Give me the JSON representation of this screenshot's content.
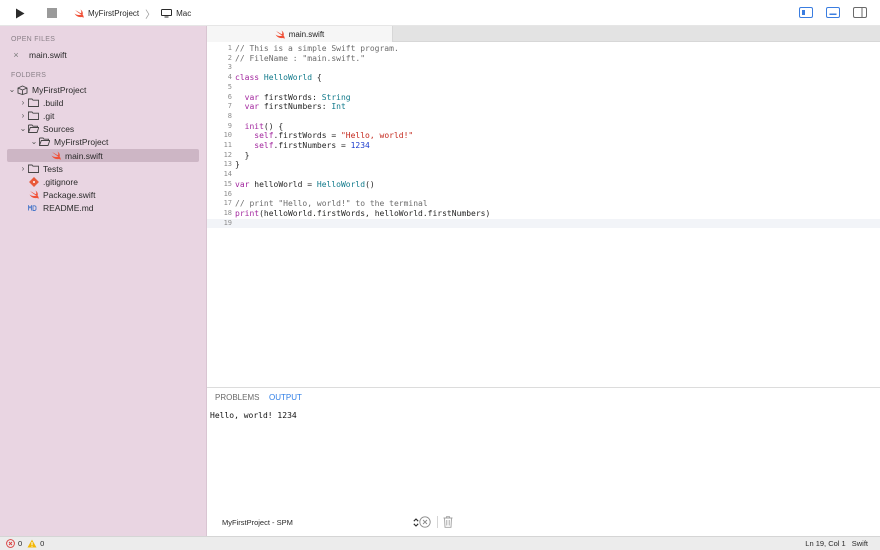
{
  "toolbar": {
    "scheme_project": "MyFirstProject",
    "scheme_destination": "Mac",
    "separator": "〉"
  },
  "sidebar": {
    "open_files_title": "OPEN FILES",
    "open_files": [
      {
        "label": "main.swift"
      }
    ],
    "folders_title": "FOLDERS",
    "tree": [
      {
        "label": "MyFirstProject",
        "chevron": "⌄",
        "icon": "package-icon"
      },
      {
        "label": ".build",
        "chevron": "›",
        "icon": "folder-icon"
      },
      {
        "label": ".git",
        "chevron": "›",
        "icon": "folder-icon"
      },
      {
        "label": "Sources",
        "chevron": "⌄",
        "icon": "folder-open-icon"
      },
      {
        "label": "MyFirstProject",
        "chevron": "⌄",
        "icon": "folder-open-icon"
      },
      {
        "label": "main.swift",
        "chevron": "",
        "icon": "swift-icon",
        "selected": true
      },
      {
        "label": "Tests",
        "chevron": "›",
        "icon": "folder-icon"
      },
      {
        "label": ".gitignore",
        "chevron": "",
        "icon": "git-icon"
      },
      {
        "label": "Package.swift",
        "chevron": "",
        "icon": "swift-icon"
      },
      {
        "label": "README.md",
        "chevron": "",
        "icon": "markdown-icon"
      }
    ]
  },
  "tabs": [
    {
      "label": "main.swift"
    }
  ],
  "editor": {
    "current_line": 19,
    "lines": [
      {
        "n": "1",
        "tokens": [
          {
            "t": "// This is a simple Swift program.",
            "c": "cm"
          }
        ]
      },
      {
        "n": "2",
        "tokens": [
          {
            "t": "// FileName : \"main.swift.\"",
            "c": "cm"
          }
        ]
      },
      {
        "n": "3",
        "tokens": []
      },
      {
        "n": "4",
        "tokens": [
          {
            "t": "class ",
            "c": "kw"
          },
          {
            "t": "HelloWorld",
            "c": "ty"
          },
          {
            "t": " {",
            "c": "pl"
          }
        ]
      },
      {
        "n": "5",
        "tokens": []
      },
      {
        "n": "6",
        "tokens": [
          {
            "t": "  var ",
            "c": "kw"
          },
          {
            "t": "firstWords: ",
            "c": "pl"
          },
          {
            "t": "String",
            "c": "ty"
          }
        ]
      },
      {
        "n": "7",
        "tokens": [
          {
            "t": "  var ",
            "c": "kw"
          },
          {
            "t": "firstNumbers: ",
            "c": "pl"
          },
          {
            "t": "Int",
            "c": "ty"
          }
        ]
      },
      {
        "n": "8",
        "tokens": []
      },
      {
        "n": "9",
        "tokens": [
          {
            "t": "  init",
            "c": "kw"
          },
          {
            "t": "() {",
            "c": "pl"
          }
        ]
      },
      {
        "n": "10",
        "tokens": [
          {
            "t": "    self",
            "c": "kw"
          },
          {
            "t": ".firstWords = ",
            "c": "pl"
          },
          {
            "t": "\"Hello, world!\"",
            "c": "st"
          }
        ]
      },
      {
        "n": "11",
        "tokens": [
          {
            "t": "    self",
            "c": "kw"
          },
          {
            "t": ".firstNumbers = ",
            "c": "pl"
          },
          {
            "t": "1234",
            "c": "nu"
          }
        ]
      },
      {
        "n": "12",
        "tokens": [
          {
            "t": "  }",
            "c": "pl"
          }
        ]
      },
      {
        "n": "13",
        "tokens": [
          {
            "t": "}",
            "c": "pl"
          }
        ]
      },
      {
        "n": "14",
        "tokens": []
      },
      {
        "n": "15",
        "tokens": [
          {
            "t": "var ",
            "c": "kw"
          },
          {
            "t": "helloWorld = ",
            "c": "pl"
          },
          {
            "t": "HelloWorld",
            "c": "ty"
          },
          {
            "t": "()",
            "c": "pl"
          }
        ]
      },
      {
        "n": "16",
        "tokens": []
      },
      {
        "n": "17",
        "tokens": [
          {
            "t": "// print \"Hello, world!\" to the terminal",
            "c": "cm"
          }
        ]
      },
      {
        "n": "18",
        "tokens": [
          {
            "t": "print",
            "c": "kw"
          },
          {
            "t": "(helloWorld.firstWords, helloWorld.firstNumbers)",
            "c": "pl"
          }
        ]
      },
      {
        "n": "19",
        "tokens": []
      }
    ]
  },
  "panel": {
    "tab_problems": "PROBLEMS",
    "tab_output": "OUTPUT",
    "output_text": "Hello, world! 1234",
    "channel": "MyFirstProject - SPM"
  },
  "status": {
    "errors": "0",
    "warnings": "0",
    "position": "Ln 19, Col 1",
    "language": "Swift"
  },
  "colors": {
    "sidebar_bg": "#e9d5e2",
    "accent": "#2f7ee6",
    "swift_orange": "#f05138",
    "error_red": "#d93b3b",
    "warning_yellow": "#e0a800"
  }
}
